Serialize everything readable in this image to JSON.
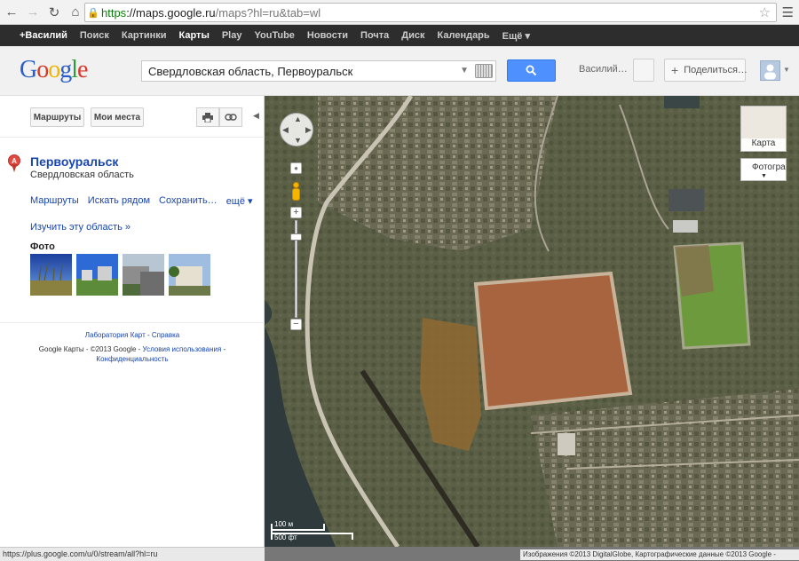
{
  "browser": {
    "url_https": "https",
    "url_host": "://maps.google.ru",
    "url_path": "/maps?hl=ru&tab=wl"
  },
  "gbar": {
    "items": [
      "+Василий",
      "Поиск",
      "Картинки",
      "Карты",
      "Play",
      "YouTube",
      "Новости",
      "Почта",
      "Диск",
      "Календарь",
      "Ещё ▾"
    ],
    "active_index": 3
  },
  "header": {
    "logo": [
      "G",
      "o",
      "o",
      "g",
      "l",
      "e"
    ],
    "search_value": "Свердловская область, Первоуральск",
    "user_name": "Василий…",
    "share_label": "Поделиться…"
  },
  "panel": {
    "routes_button": "Маршруты",
    "my_places_button": "Мои места",
    "pin_letter": "A",
    "place_title": "Первоуральск",
    "place_subtitle": "Свердловская область",
    "links": [
      "Маршруты",
      "Искать рядом",
      "Сохранить…",
      "ещё ▾"
    ],
    "explore_link": "Изучить эту область »",
    "photos_label": "Фото",
    "footer": {
      "labs": "Лаборатория Карт",
      "dot": " - ",
      "help": "Справка",
      "line2_plain": "Google Карты - ©2013 Google - ",
      "terms": "Условия использования",
      "dash": " -",
      "privacy": "Конфиденциальность"
    }
  },
  "map": {
    "type_map_label": "Карта",
    "type_sat_label": "Фотограф",
    "scale_m": "100 м",
    "scale_ft": "500 фт",
    "copyright": "Изображения ©2013 DigitalGlobe, Картографические данные ©2013 Google -"
  },
  "status": {
    "text": "https://plus.google.com/u/0/stream/all?hl=ru"
  }
}
